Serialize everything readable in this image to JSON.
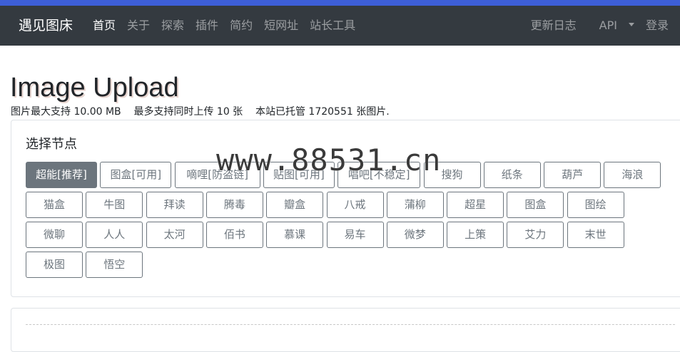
{
  "navbar": {
    "brand": "遇见图床",
    "left_items": [
      {
        "label": "首页",
        "active": true
      },
      {
        "label": "关于"
      },
      {
        "label": "探索"
      },
      {
        "label": "插件"
      },
      {
        "label": "简约"
      },
      {
        "label": "短网址"
      },
      {
        "label": "站长工具"
      }
    ],
    "right_items": [
      {
        "label": "更新日志"
      },
      {
        "label": "API"
      },
      {
        "label": "登录"
      }
    ]
  },
  "page": {
    "title": "Image Upload",
    "stats": "图片最大支持 10.00 MB    最多支持同时上传 10 张    本站已托管 1720551 张图片."
  },
  "nodes_card": {
    "title": "选择节点",
    "nodes": [
      "超能[推荐]",
      "图盒[可用]",
      "嘀哩[防盗链]",
      "贴图[可用]",
      "唱吧[不稳定]",
      "搜狗",
      "纸条",
      "葫芦",
      "海浪",
      "猫盒",
      "牛图",
      "拜读",
      "腾毒",
      "瓣盒",
      "八戒",
      "蒲柳",
      "超星",
      "图盒",
      "图绘",
      "微聊",
      "人人",
      "太河",
      "佰书",
      "慕课",
      "易车",
      "微梦",
      "上策",
      "艾力",
      "末世",
      "极图",
      "悟空"
    ]
  },
  "watermark": "www.88531.cn",
  "colors": {
    "topline": "#3d5fd8",
    "navbar": "#343a40",
    "node_border": "#6c757d"
  }
}
